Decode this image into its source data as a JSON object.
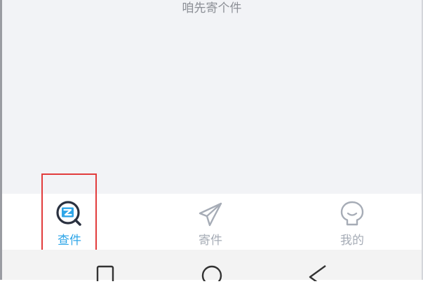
{
  "content": {
    "empty_hint": "咱先寄个件"
  },
  "tabbar": {
    "active_color": "#2fa6e8",
    "inactive_color": "#a6acb6",
    "tabs": [
      {
        "label": "查件",
        "icon": "search-parcel-icon",
        "active": true
      },
      {
        "label": "寄件",
        "icon": "paper-plane-icon",
        "active": false
      },
      {
        "label": "我的",
        "icon": "user-profile-icon",
        "active": false
      }
    ]
  },
  "annotation": {
    "highlight_color": "#e23c3c",
    "highlighted_tab": "查件"
  },
  "navbar": {
    "buttons": [
      "recent-apps-icon",
      "home-icon",
      "back-icon"
    ]
  }
}
